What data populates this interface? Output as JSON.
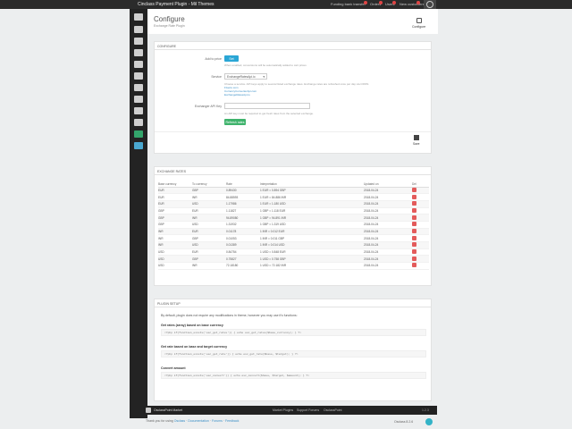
{
  "topbar": {
    "title": "Cinclass Payment Plugin - Mil Themes",
    "funding": "Funding bank transfer",
    "orders": "Orders",
    "users": "Users",
    "new": "New customers",
    "badges": [
      "3",
      "0",
      "0",
      "7"
    ]
  },
  "header": {
    "title": "Configure",
    "subtitle": "Exchange Rate Plugin",
    "configure_label": "Configure"
  },
  "configure": {
    "section_title": "Configure",
    "add_label": "Add to price",
    "toggle": "Set",
    "add_help": "When enabled, conversions will be automatically added to cart prices",
    "service_label": "Service",
    "service_value": "ExchangeRatesApi.io",
    "service_help": "Choose a service. API keys apply to several listed exchange rates. Exchange rates are refreshed once per day via CRON.",
    "service_links": [
      "Fixerio.com",
      "CurrencyConverterApi.com",
      "ExchangeRatesApi.io"
    ],
    "api_label": "Exchanger API Key",
    "api_value": "",
    "api_help": "An API key must be required to get fresh rates from the selected exchange.",
    "refresh_button": "Refresh rates",
    "save_label": "Save"
  },
  "rates": {
    "section_title": "Exchange rates",
    "columns": [
      "Base currency",
      "To currency",
      "Rate",
      "Interpretation",
      "Updated on",
      "Del"
    ],
    "rows": [
      [
        "EUR",
        "GBP",
        "0.89430",
        "1 EUR = 0.894 GBP",
        "2018-04-24"
      ],
      [
        "EUR",
        "INR",
        "84.88593",
        "1 EUR = 84.886 INR",
        "2018-04-24"
      ],
      [
        "EUR",
        "USD",
        "1.17986",
        "1 EUR = 1.180 USD",
        "2018-04-24"
      ],
      [
        "GBP",
        "EUR",
        "1.11827",
        "1 GBP = 1.118 EUR",
        "2018-04-24"
      ],
      [
        "GBP",
        "INR",
        "94.89080",
        "1 GBP = 94.891 INR",
        "2018-04-24"
      ],
      [
        "GBP",
        "USD",
        "1.31932",
        "1 GBP = 1.319 USD",
        "2018-04-24"
      ],
      [
        "INR",
        "EUR",
        "0.01178",
        "1 INR = 0.012 EUR",
        "2018-04-24"
      ],
      [
        "INR",
        "GBP",
        "0.01053",
        "1 INR = 0.011 GBP",
        "2018-04-24"
      ],
      [
        "INR",
        "USD",
        "0.01389",
        "1 INR = 0.014 USD",
        "2018-04-24"
      ],
      [
        "USD",
        "EUR",
        "0.84754",
        "1 USD = 0.848 EUR",
        "2018-04-24"
      ],
      [
        "USD",
        "GBP",
        "0.75827",
        "1 USD = 0.758 GBP",
        "2018-04-24"
      ],
      [
        "USD",
        "INR",
        "72.18180",
        "1 USD = 72.182 INR",
        "2018-04-24"
      ]
    ]
  },
  "plugin": {
    "section_title": "Plugin setup",
    "intro": "By default, plugin does not require any modifications in theme, however you may use it's functions:",
    "items": [
      {
        "title": "Get rates (array) based on base currency",
        "code": "<?php if(function_exists('osc_get_rates')) { echo osc_get_rates($base_currency); } ?>"
      },
      {
        "title": "Get rate based on base and target currency",
        "code": "<?php if(function_exists('osc_get_rate')) { echo osc_get_rate($base, $target); } ?>"
      },
      {
        "title": "Convert amount",
        "code": "<?php if(function_exists('osc_convert')) { echo osc_convert($base, $target, $amount); } ?>"
      }
    ]
  },
  "bottombar": {
    "left": "OsclassPoint Market",
    "links": [
      "Market Plugins",
      "Support Forums",
      "OsclassPoint"
    ],
    "right": "1.2.3"
  },
  "footer": {
    "thanks": "Thank you for using",
    "osclass": "Osclass",
    "links": [
      "Documentation",
      "Forums",
      "Feedback"
    ],
    "version": "Osclass 8.2.6"
  }
}
